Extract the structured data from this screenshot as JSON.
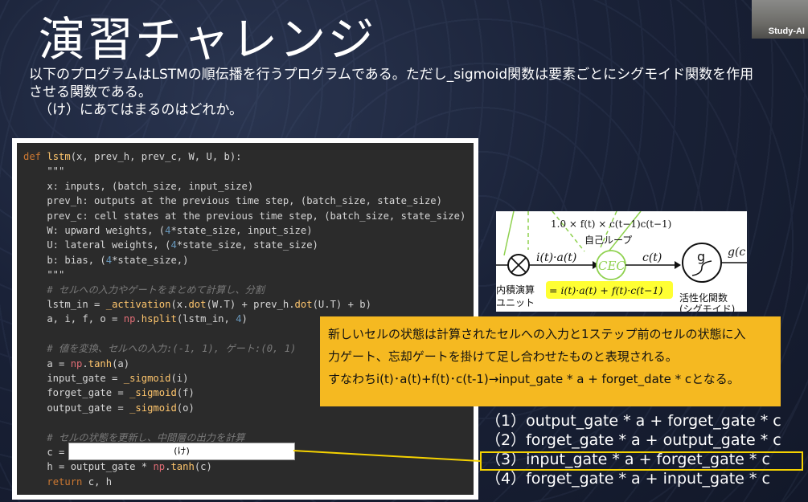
{
  "slide": {
    "title": "演習チャレンジ",
    "video_label": "Study-AI",
    "desc_line1": "以下のプログラムはLSTMの順伝播を行うプログラムである。ただし_sigmoid関数は要素ごとにシグモイド関数を作用",
    "desc_line2": "させる関数である。",
    "question": "（け）にあてはまるのはどれか。"
  },
  "code": {
    "lines": [
      "def lstm(x, prev_h, prev_c, W, U, b):",
      "    \"\"\"",
      "    x: inputs, (batch_size, input_size)",
      "    prev_h: outputs at the previous time step, (batch_size, state_size)",
      "    prev_c: cell states at the previous time step, (batch_size, state_size)",
      "    W: upward weights, (4*state_size, input_size)",
      "    U: lateral weights, (4*state_size, state_size)",
      "    b: bias, (4*state_size,)",
      "    \"\"\"",
      "    # セルへの入力やゲートをまとめて計算し、分割",
      "    lstm_in = _activation(x.dot(W.T) + prev_h.dot(U.T) + b)",
      "    a, i, f, o = np.hsplit(lstm_in, 4)",
      "",
      "    # 値を変換、セルへの入力:(-1, 1), ゲート:(0, 1)",
      "    a = np.tanh(a)",
      "    input_gate = _sigmoid(i)",
      "    forget_gate = _sigmoid(f)",
      "    output_gate = _sigmoid(o)",
      "",
      "    # セルの状態を更新し、中間層の出力を計算",
      "    c =",
      "    h = output_gate * np.tanh(c)",
      "    return c, h"
    ],
    "blank_label": "(け)"
  },
  "diagram": {
    "top_formula": "1.0 × f(t) × c(t−1)c(t−1)",
    "self_loop": "自己ループ",
    "ia_label": "i(t)·a(t)",
    "cec": "CEC",
    "ct": "c(t)",
    "g": "g",
    "gc": "g(c",
    "inner_product_1": "内積演算",
    "inner_product_2": "ユニット",
    "highlight_formula": "= i(t)·a(t) + f(t)·c(t−1)",
    "activation_1": "活性化関数",
    "activation_2": "(シグモイド)"
  },
  "callout": {
    "line1": "新しいセルの状態は計算されたセルへの入力と1ステップ前のセルの状態に入",
    "line2": "力ゲート、忘却ゲートを掛けて足し合わせたものと表現される。",
    "line3": "すなわちi(t)･a(t)+f(t)･c(t-1)→input_gate * a + forget_date * cとなる。"
  },
  "choices": [
    "（1）output_gate * a + forget_gate * c",
    "（2）forget_gate * a + output_gate * c",
    "（3）input_gate * a + forget_gate * c",
    "（4）forget_gate * a + input_gate * c"
  ],
  "colors": {
    "callout": "#f5b921",
    "highlight": "#f5d200",
    "code_bg": "#2b2b2b"
  }
}
